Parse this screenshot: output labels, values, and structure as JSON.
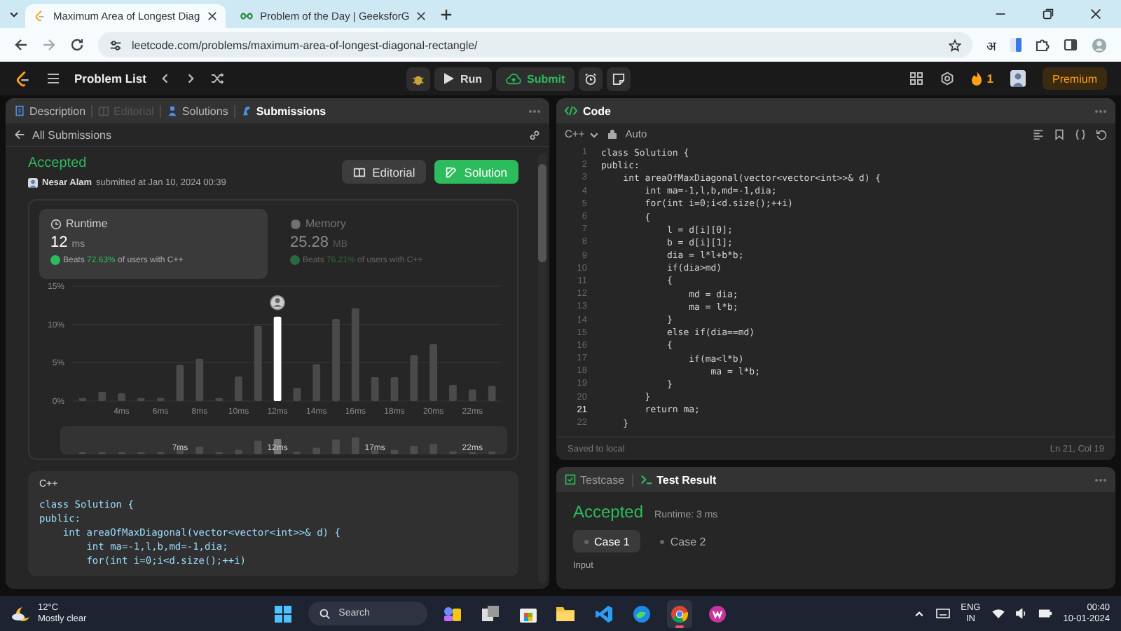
{
  "browser": {
    "tabs": [
      {
        "title": "Maximum Area of Longest Diag",
        "kind": "leetcode",
        "selected": true
      },
      {
        "title": "Problem of the Day | GeeksforG",
        "kind": "gfg",
        "selected": false
      }
    ],
    "url": "leetcode.com/problems/maximum-area-of-longest-diagonal-rectangle/",
    "translate_label": "अ"
  },
  "nav": {
    "problem_list": "Problem List",
    "run": "Run",
    "submit": "Submit",
    "streak": "1",
    "premium": "Premium"
  },
  "left_panel": {
    "tabs": [
      {
        "label": "Description",
        "selected": false,
        "disabled": false
      },
      {
        "label": "Editorial",
        "selected": false,
        "disabled": true
      },
      {
        "label": "Solutions",
        "selected": false,
        "disabled": false
      },
      {
        "label": "Submissions",
        "selected": true,
        "disabled": false
      }
    ],
    "back_link": "All Submissions",
    "status": "Accepted",
    "author": "Nesar Alam",
    "submitted": "submitted at Jan 10, 2024 00:39",
    "buttons": [
      {
        "label": "Editorial",
        "kind": "secondary"
      },
      {
        "label": "Solution",
        "kind": "primary"
      }
    ],
    "stats": [
      {
        "kind": "runtime",
        "title": "Runtime",
        "value": "12",
        "unit": "ms",
        "beats_label": "Beats",
        "beats": "72.63%",
        "suffix": "of users with C++",
        "selected": true
      },
      {
        "kind": "memory",
        "title": "Memory",
        "value": "25.28",
        "unit": "MB",
        "beats_label": "Beats",
        "beats": "76.21%",
        "suffix": "of users with C++",
        "selected": false
      }
    ],
    "chart_data": {
      "type": "bar",
      "x": [
        2,
        3,
        4,
        5,
        6,
        7,
        8,
        9,
        10,
        11,
        12,
        13,
        14,
        15,
        16,
        17,
        18,
        19,
        20,
        21,
        22,
        23
      ],
      "series": [
        {
          "color": "#4a4a4a",
          "values": [
            0.4,
            1.2,
            1.0,
            0.4,
            0.4,
            4.7,
            5.5,
            0.4,
            3.2,
            9.8,
            null,
            1.7,
            4.8,
            10.7,
            12.1,
            3.1,
            3.1,
            6.0,
            7.4,
            2.1,
            1.5,
            2.0
          ]
        },
        {
          "color": "#ffffff",
          "values": [
            null,
            null,
            null,
            null,
            null,
            null,
            null,
            null,
            null,
            null,
            11.0,
            null,
            null,
            null,
            null,
            null,
            null,
            null,
            null,
            null,
            null,
            null
          ]
        }
      ],
      "stacked": true,
      "xlim": [
        1.5,
        23.5
      ],
      "yticks": [
        {
          "value": 0,
          "label": "0%"
        },
        {
          "value": 5,
          "label": "5%"
        },
        {
          "value": 10,
          "label": "10%"
        },
        {
          "value": 15,
          "label": "15%"
        }
      ],
      "xticks": [
        {
          "value": 4,
          "label": "4ms"
        },
        {
          "value": 6,
          "label": "6ms"
        },
        {
          "value": 8,
          "label": "8ms"
        },
        {
          "value": 10,
          "label": "10ms"
        },
        {
          "value": 12,
          "label": "12ms"
        },
        {
          "value": 14,
          "label": "14ms"
        },
        {
          "value": 16,
          "label": "16ms"
        },
        {
          "value": 18,
          "label": "18ms"
        },
        {
          "value": 20,
          "label": "20ms"
        },
        {
          "value": 22,
          "label": "22ms"
        }
      ],
      "ylim": [
        0,
        15
      ]
    },
    "navigator_labels": [
      "7ms",
      "12ms",
      "17ms",
      "22ms"
    ],
    "code_card": {
      "language": "C++",
      "lines": [
        "class Solution {",
        "public:",
        "    int areaOfMaxDiagonal(vector<vector<int>>& d) {",
        "        int ma=-1,l,b,md=-1,dia;",
        "        for(int i=0;i<d.size();++i)"
      ]
    }
  },
  "editor": {
    "title": "Code",
    "language": "C++",
    "mode": "Auto",
    "lines": [
      {
        "n": "1",
        "code": "class Solution {",
        "current": false
      },
      {
        "n": "2",
        "code": "public:",
        "current": false
      },
      {
        "n": "3",
        "code": "    int areaOfMaxDiagonal(vector<vector<int>>& d) {",
        "current": false
      },
      {
        "n": "4",
        "code": "        int ma=-1,l,b,md=-1,dia;",
        "current": false
      },
      {
        "n": "5",
        "code": "        for(int i=0;i<d.size();++i)",
        "current": false
      },
      {
        "n": "6",
        "code": "        {",
        "current": false
      },
      {
        "n": "7",
        "code": "            l = d[i][0];",
        "current": false
      },
      {
        "n": "8",
        "code": "            b = d[i][1];",
        "current": false
      },
      {
        "n": "9",
        "code": "            dia = l*l+b*b;",
        "current": false
      },
      {
        "n": "10",
        "code": "            if(dia>md)",
        "current": false
      },
      {
        "n": "11",
        "code": "            {",
        "current": false
      },
      {
        "n": "12",
        "code": "                md = dia;",
        "current": false
      },
      {
        "n": "13",
        "code": "                ma = l*b;",
        "current": false
      },
      {
        "n": "14",
        "code": "            }",
        "current": false
      },
      {
        "n": "15",
        "code": "            else if(dia==md)",
        "current": false
      },
      {
        "n": "16",
        "code": "            {",
        "current": false
      },
      {
        "n": "17",
        "code": "                if(ma<l*b)",
        "current": false
      },
      {
        "n": "18",
        "code": "                    ma = l*b;",
        "current": false
      },
      {
        "n": "19",
        "code": "            }",
        "current": false
      },
      {
        "n": "20",
        "code": "        }",
        "current": false
      },
      {
        "n": "21",
        "code": "        return ma;",
        "current": true
      },
      {
        "n": "22",
        "code": "    }",
        "current": false
      }
    ],
    "status": "Saved to local",
    "cursor": "Ln 21, Col 19"
  },
  "console": {
    "tabs": [
      {
        "label": "Testcase",
        "selected": false
      },
      {
        "label": "Test Result",
        "selected": true
      }
    ],
    "status": "Accepted",
    "runtime": "Runtime: 3 ms",
    "cases": [
      {
        "label": "Case 1",
        "selected": true
      },
      {
        "label": "Case 2",
        "selected": false
      }
    ],
    "input_label": "Input"
  },
  "taskbar": {
    "temperature": "12°C",
    "weather": "Mostly clear",
    "search": "Search",
    "apps": [
      {
        "kind": "widgets",
        "selected": false
      },
      {
        "kind": "taskview",
        "selected": false
      },
      {
        "kind": "store",
        "selected": false
      },
      {
        "kind": "files",
        "selected": false
      },
      {
        "kind": "vscode",
        "selected": false
      },
      {
        "kind": "edge",
        "selected": false
      },
      {
        "kind": "chrome",
        "selected": true
      },
      {
        "kind": "office",
        "selected": false
      }
    ],
    "language": "ENG",
    "region": "IN",
    "time": "00:40",
    "date": "10-01-2024"
  }
}
